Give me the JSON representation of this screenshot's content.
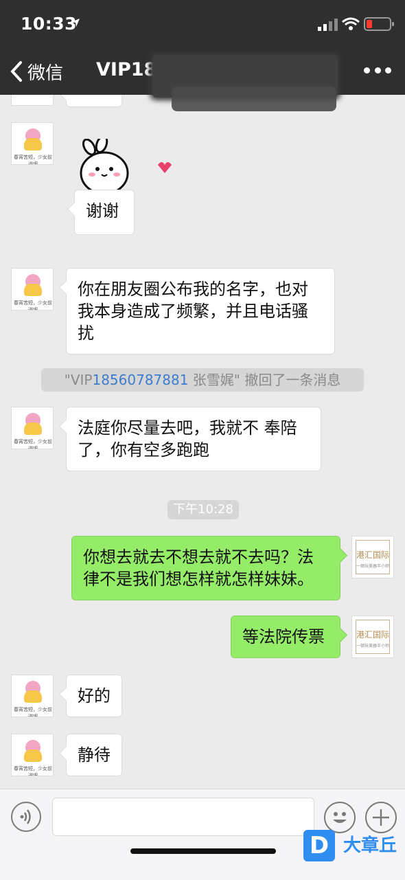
{
  "status_bar": {
    "time": "10:33"
  },
  "nav": {
    "back_label": "微信",
    "title": "VIP18"
  },
  "messages": [
    {
      "side": "left",
      "type": "text",
      "text": "谢谢"
    },
    {
      "side": "left",
      "type": "text",
      "text": "你在朋友圈公布我的名字，也对我本身造成了频繁，并且电话骚扰"
    },
    {
      "side": "left",
      "type": "text",
      "text": "法庭你尽量去吧，我就不 奉陪了，你有空多跑跑"
    },
    {
      "side": "right",
      "type": "text",
      "text": "你想去就去不想去就不去吗？法律不是我们想怎样就怎样妹妹。"
    },
    {
      "side": "right",
      "type": "text",
      "text": "等法院传票"
    },
    {
      "side": "left",
      "type": "text",
      "text": "好的"
    },
    {
      "side": "left",
      "type": "text",
      "text": "静待"
    }
  ],
  "recall_notice": {
    "prefix": "\"VIP",
    "link": "18560787881",
    "suffix": " 张雪娓\" 撤回了一条消息"
  },
  "timestamp": "下午10:28",
  "avatars": {
    "contact_caption": "春宵苦短，少女前进吧",
    "me_brand": "港汇国际",
    "me_brand_sub": "一顿玩美器半小师"
  },
  "watermark": {
    "logo": "D",
    "text": "大章丘"
  },
  "colors": {
    "header_bg": "#2f2f2f",
    "chat_bg": "#ebebeb",
    "out_bubble": "#95ec69",
    "in_bubble": "#ffffff",
    "link": "#3c7ccf"
  }
}
